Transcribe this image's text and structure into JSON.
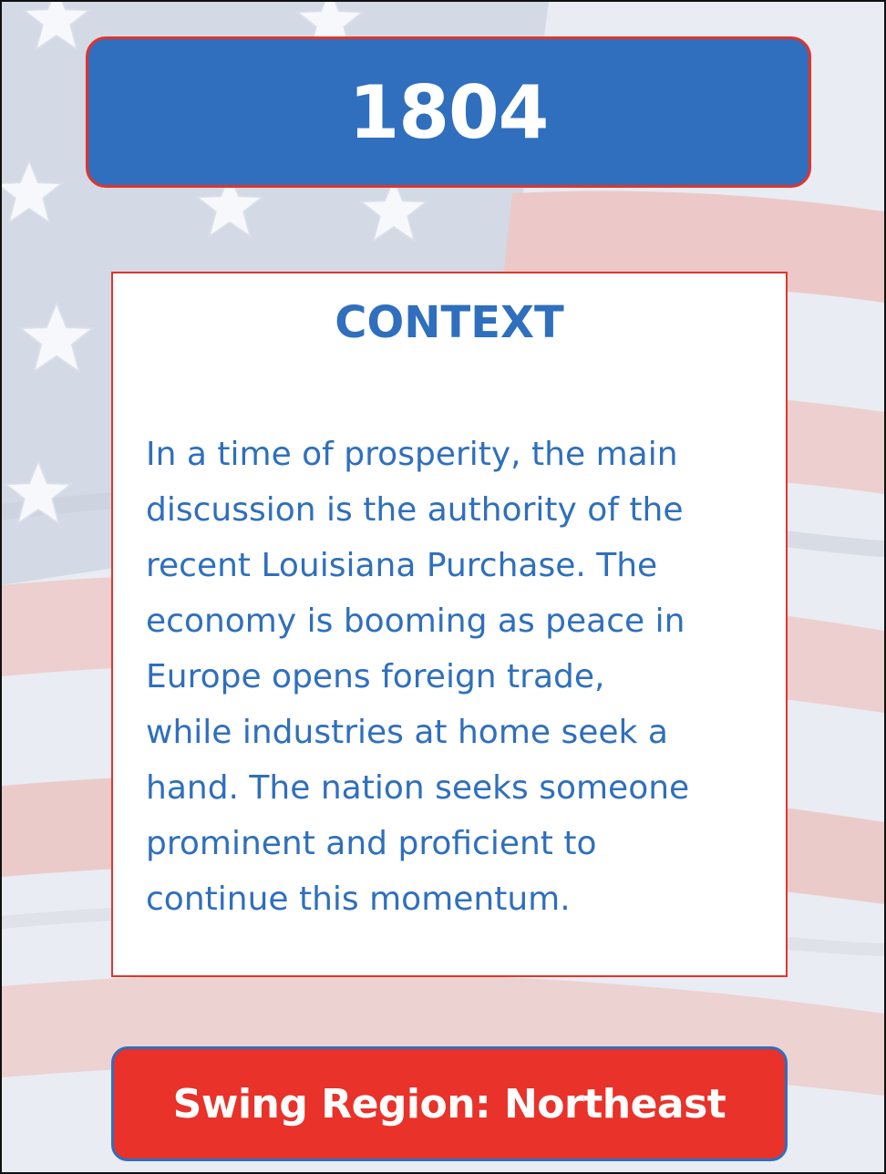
{
  "header": {
    "year": "1804"
  },
  "context": {
    "heading": "CONTEXT",
    "body": "In a time of prosperity, the main\ndiscussion is the authority of the\nrecent Louisiana Purchase. The\neconomy is booming as peace in\nEurope opens foreign trade,\nwhile industries at home seek a\nhand. The nation seeks someone\nprominent and proficient to\ncontinue this momentum."
  },
  "footer": {
    "swing_region": "Swing Region: Northeast"
  },
  "background": {
    "image": "american-flag"
  },
  "colors": {
    "blue": "#2f6fbd",
    "red": "#e1342b",
    "white": "#ffffff"
  }
}
